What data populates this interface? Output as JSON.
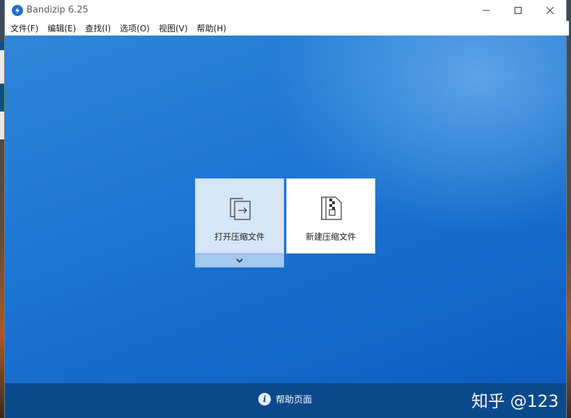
{
  "window": {
    "title": "Bandizip 6.25",
    "controls": [
      "minimize-icon",
      "maximize-icon",
      "close-icon"
    ]
  },
  "menu": [
    {
      "label": "文件(F)"
    },
    {
      "label": "编辑(E)"
    },
    {
      "label": "查找(I)"
    },
    {
      "label": "选项(O)"
    },
    {
      "label": "视图(V)"
    },
    {
      "label": "帮助(H)"
    }
  ],
  "main": {
    "open_archive": {
      "label": "打开压缩文件",
      "icon": "open-archive-icon"
    },
    "new_archive": {
      "label": "新建压缩文件",
      "icon": "new-archive-icon"
    },
    "dropdown_icon": "chevron-down-icon"
  },
  "footer": {
    "help_label": "帮助页面",
    "help_icon": "info-icon",
    "watermark": "知乎 @123"
  },
  "colors": {
    "accent": "#1d74d2",
    "footer": "#0a4a8c",
    "selected_card": "#d4e6f7"
  }
}
